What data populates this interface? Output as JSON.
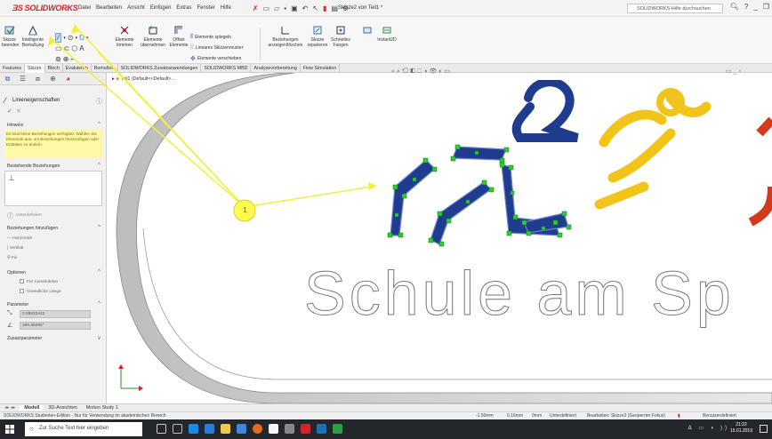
{
  "titlebar": {
    "menu": [
      "Datei",
      "Bearbeiten",
      "Ansicht",
      "Einfügen",
      "Extras",
      "Fenster",
      "Hilfe"
    ],
    "document_title": "Skizze2 von Teil1 *",
    "help_search": "SOLIDWORKS Hilfe durchsuchen"
  },
  "toolbar": {
    "exit_sketch": "Skizze beenden",
    "smart_dimension": "Intelligente Bemaßung",
    "trim": "Elemente trimmen",
    "convert": "Elemente übernehmen",
    "offset": "Offset Elemente",
    "mirror": "Elemente spiegeln",
    "linear_pattern": "Lineares Skizzenmuster",
    "move": "Elemente verschieben",
    "relations": "Beziehungen anzeigen/löschen",
    "repair": "Skizze reparieren",
    "quick_snaps": "Schnelles Fangen",
    "instant2d": "Instant2D"
  },
  "tabs": [
    "Features",
    "Skizze",
    "Blech",
    "Evaluieren",
    "Bemaßen",
    "SOLIDWORKS Zusatzanwendungen",
    "SOLIDWORKS MBD",
    "Analysevorbereitung",
    "Flow Simulation"
  ],
  "panel": {
    "title": "Linieneigenschaften",
    "hint_label": "Hinweis",
    "hint_text": "Es sind keine Beziehungen verfügbar. Wählen Sie Elemente aus, um Beziehungen hinzuzufügen oder Entitäten zu ändern.",
    "existing_relations": "Bestehende Beziehungen",
    "under_defined": "Unterdefiniert",
    "add_relations": "Beziehungen hinzufügen",
    "rel_horizontal": "Horizontal",
    "rel_vertical": "Vertikal",
    "rel_fix": "Fix",
    "options": "Optionen",
    "opt_construction": "Für Konstruktion",
    "opt_infinite": "Unendliche Länge",
    "parameters": "Parameter",
    "param1": "0.55833442",
    "param2": "265.55095°",
    "extra_params": "Zusatzparameter"
  },
  "canvas": {
    "tree_label": "Teil1 (Default<<Default>...",
    "school_text": "Schule am Sp",
    "callout_number": "1"
  },
  "model_tabs": [
    "Modell",
    "3D-Ansichten",
    "Motion Study 1"
  ],
  "status": {
    "edition": "SOLIDWORKS Studenten-Edition - Nur für Verwendung im akademischen Bereich",
    "x": "-1.50mm",
    "y": "0.16mm",
    "z": "0mm",
    "defined": "Unterdefiniert",
    "editing": "Bearbeiten: Skizze2 (Gesperrter Fokus)",
    "units": "Benutzerdefiniert"
  },
  "taskbar": {
    "search_placeholder": "Zur Suche Text hier eingeben",
    "time": "21:22",
    "date": "15.01.2019"
  },
  "colors": {
    "accent": "#d2232a",
    "sketch_blue": "#1f3c8f",
    "sketch_point": "#2fcc2f",
    "callout": "#fffb4d",
    "logo_yellow": "#f2c41a",
    "logo_red": "#d43a1a"
  }
}
